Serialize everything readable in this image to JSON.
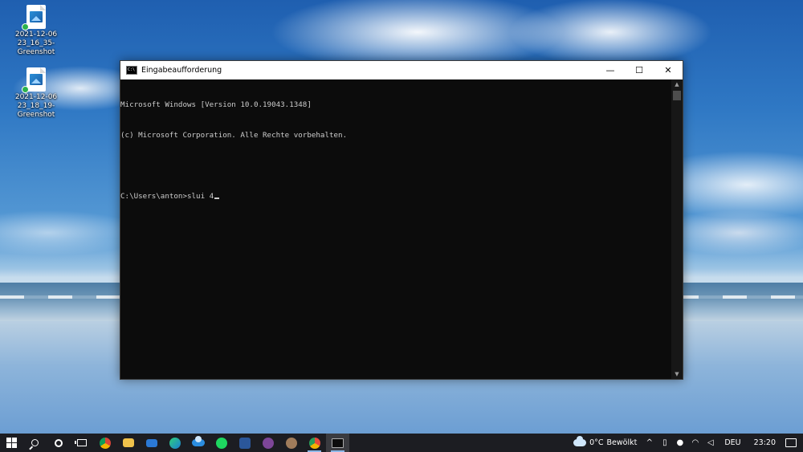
{
  "desktop": {
    "icons": [
      {
        "label_line1": "2021-12-06",
        "label_line2": "23_16_35-Greenshot"
      },
      {
        "label_line1": "2021-12-06",
        "label_line2": "23_18_19-Greenshot"
      }
    ]
  },
  "window": {
    "title": "Eingabeaufforderung",
    "icon_text": "C:\\",
    "controls": {
      "minimize": "—",
      "maximize": "☐",
      "close": "✕"
    },
    "console_lines": [
      "Microsoft Windows [Version 10.0.19043.1348]",
      "(c) Microsoft Corporation. Alle Rechte vorbehalten.",
      "",
      "C:\\Users\\anton>slui 4"
    ]
  },
  "taskbar": {
    "apps": [
      {
        "name": "chrome",
        "color": "#e8b93a"
      },
      {
        "name": "file-explorer",
        "color": "#f0c24b"
      },
      {
        "name": "mail",
        "color": "#2b79d6"
      },
      {
        "name": "edge",
        "color": "#2fa3e0"
      },
      {
        "name": "onedrive",
        "color": "#1a6fd1"
      },
      {
        "name": "spotify",
        "color": "#1ed760"
      },
      {
        "name": "word",
        "color": "#2b579a"
      },
      {
        "name": "tor-browser",
        "color": "#7d4698"
      },
      {
        "name": "gimp",
        "color": "#a07c5b"
      },
      {
        "name": "chrome-2",
        "color": "#e94b3c"
      },
      {
        "name": "command-prompt",
        "color": "#0c0c0c"
      }
    ],
    "weather": {
      "temperature": "0°C",
      "condition": "Bewölkt"
    },
    "language": "DEU",
    "time": "23:20"
  },
  "colors": {
    "console_bg": "#0c0c0c",
    "console_text": "#cccccc",
    "taskbar_bg": "#1c1d22"
  }
}
